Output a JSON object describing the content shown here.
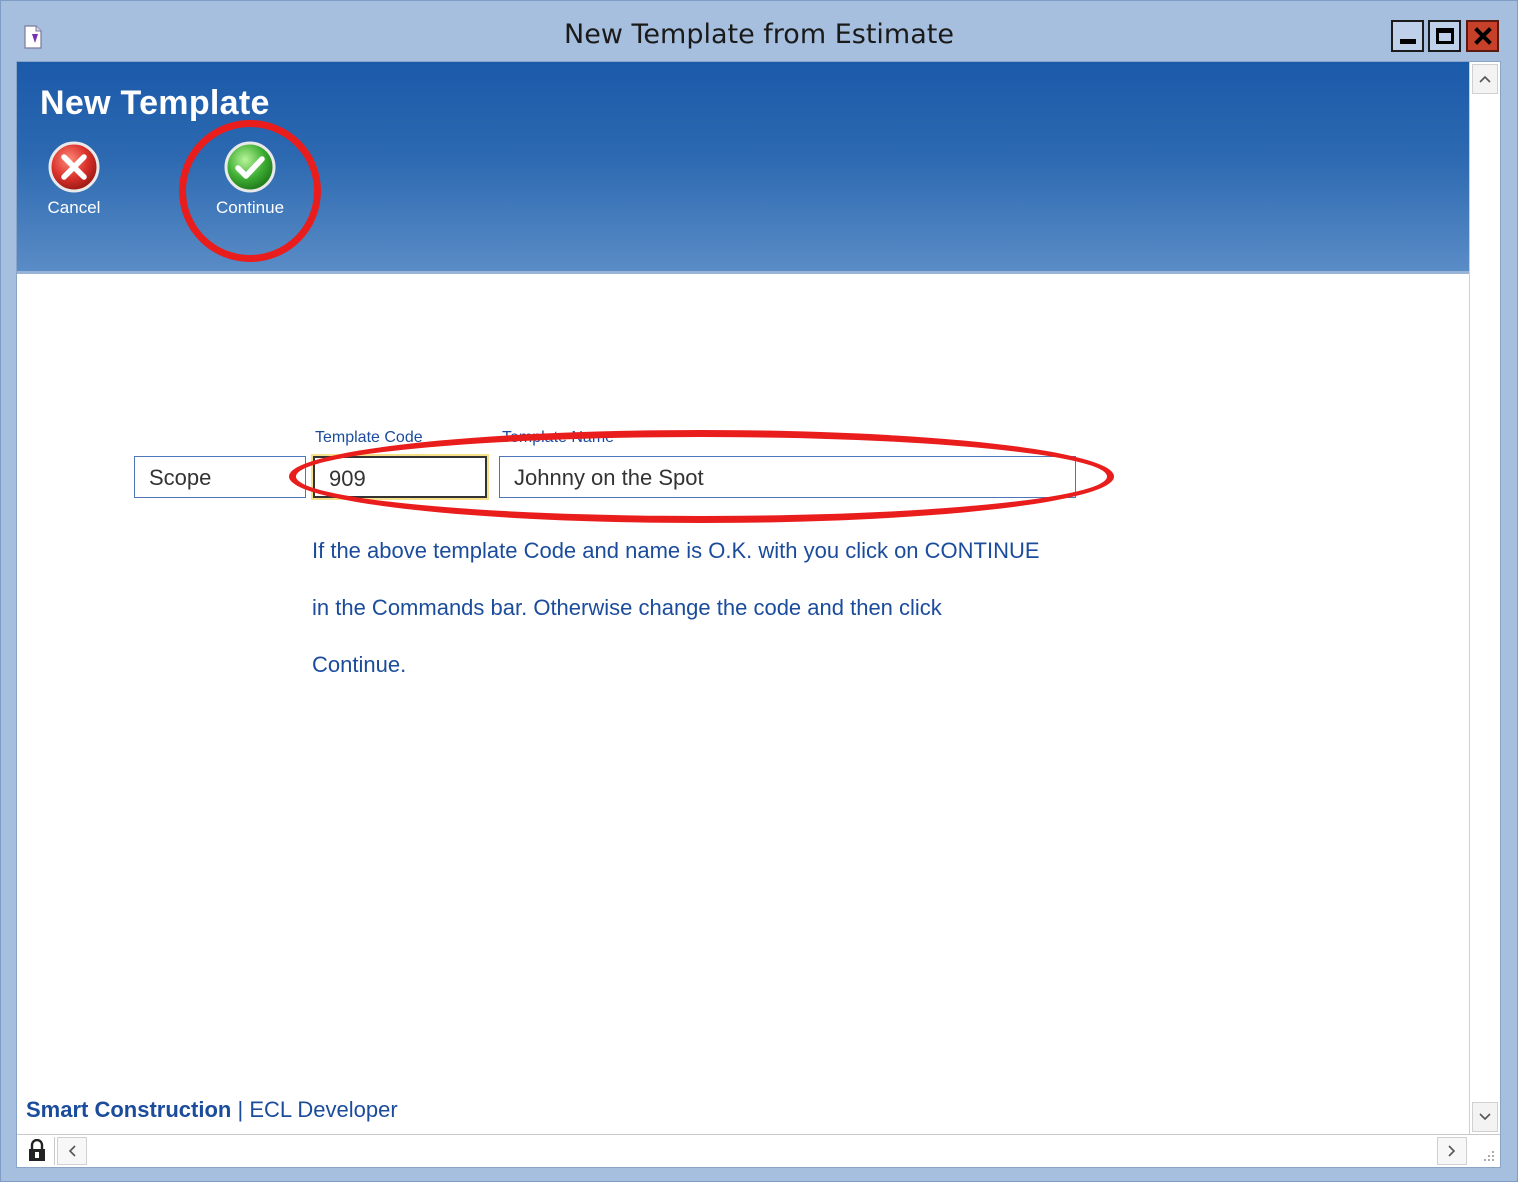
{
  "window": {
    "title": "New Template from Estimate",
    "icons": {
      "app": "document-icon",
      "minimize": "minimize-icon",
      "maximize": "maximize-icon",
      "close": "close-icon"
    }
  },
  "header": {
    "title": "New Template",
    "commands": [
      {
        "label": "Cancel",
        "icon": "cancel-x-icon",
        "color": "#d9302a"
      },
      {
        "label": "Continue",
        "icon": "check-icon",
        "color": "#3fae34"
      }
    ]
  },
  "form": {
    "scope": {
      "value": "Scope"
    },
    "code": {
      "label": "Template Code",
      "value": "909"
    },
    "name": {
      "label": "Template Name",
      "value": "Johnny on the Spot"
    }
  },
  "instructions": {
    "line1": "If the above template Code and name is O.K. with you click on CONTINUE",
    "line2": "in the Commands bar.  Otherwise change the code and then click",
    "line3": "Continue."
  },
  "footer": {
    "brand": "Smart Construction",
    "separator": " | ",
    "user": "ECL Developer"
  },
  "colors": {
    "annotation_ring": "#ea1d1d",
    "header_top": "#1b5aaa",
    "text_blue": "#1b4c9c"
  }
}
